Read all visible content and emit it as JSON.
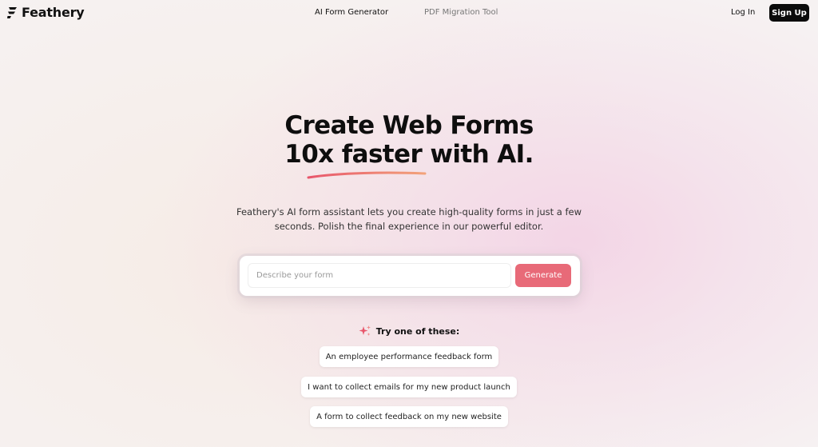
{
  "nav": {
    "brand": "Feathery",
    "links": [
      "AI Form Generator",
      "PDF Migration Tool"
    ],
    "login": "Log In",
    "signup": "Sign Up"
  },
  "hero": {
    "title_line1": "Create Web Forms",
    "title_line2": "10x faster with AI.",
    "subtitle_line1": "Feathery's AI form assistant lets you create high-quality forms in just a few",
    "subtitle_line2": "seconds. Polish the final experience in our powerful editor."
  },
  "form": {
    "placeholder": "Describe your form",
    "value": "",
    "button": "Generate"
  },
  "suggestions": {
    "heading": "Try one of these:",
    "items": [
      "An employee performance feedback form",
      "I want to collect emails for my new product launch",
      "A form to collect feedback on my new website"
    ]
  },
  "colors": {
    "accent": "#e86a78",
    "signup_bg": "#0b0b0b",
    "underline_start": "#e8566b",
    "underline_end": "#f2a37a"
  },
  "icons": {
    "logo": "feather-logo-icon",
    "sparkle": "sparkle-icon"
  }
}
